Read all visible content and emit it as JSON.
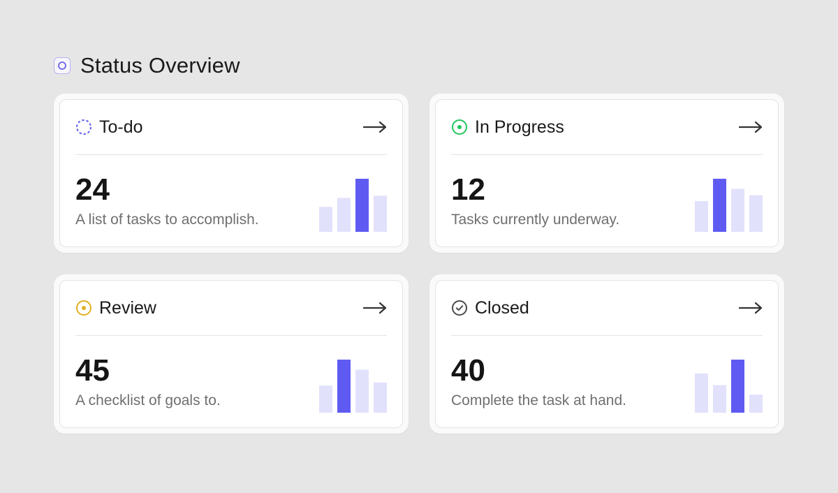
{
  "header": {
    "title": "Status Overview"
  },
  "colors": {
    "bar_muted": "#e2e1fb",
    "bar_highlight": "#5f5bf2",
    "todo": "#5f5bf2",
    "in_progress": "#22c55e",
    "review": "#e3b021",
    "closed": "#4a4a4a"
  },
  "cards": [
    {
      "title": "To-do",
      "count": "24",
      "description": "A list of tasks to accomplish.",
      "icon": "dashed-circle-icon",
      "arrow": "→",
      "bars": [
        0.47,
        0.64,
        1.0,
        0.68
      ],
      "highlight": 2
    },
    {
      "title": "In Progress",
      "count": "12",
      "description": "Tasks currently underway.",
      "icon": "dot-circle-icon",
      "arrow": "→",
      "bars": [
        0.58,
        1.0,
        0.81,
        0.69
      ],
      "highlight": 1
    },
    {
      "title": "Review",
      "count": "45",
      "description": "A checklist of goals to.",
      "icon": "dot-circle-icon",
      "arrow": "→",
      "bars": [
        0.51,
        1.0,
        0.81,
        0.57
      ],
      "highlight": 1
    },
    {
      "title": "Closed",
      "count": "40",
      "description": "Complete the task at hand.",
      "icon": "check-circle-icon",
      "arrow": "→",
      "bars": [
        0.74,
        0.52,
        1.0,
        0.34
      ],
      "highlight": 2
    }
  ]
}
